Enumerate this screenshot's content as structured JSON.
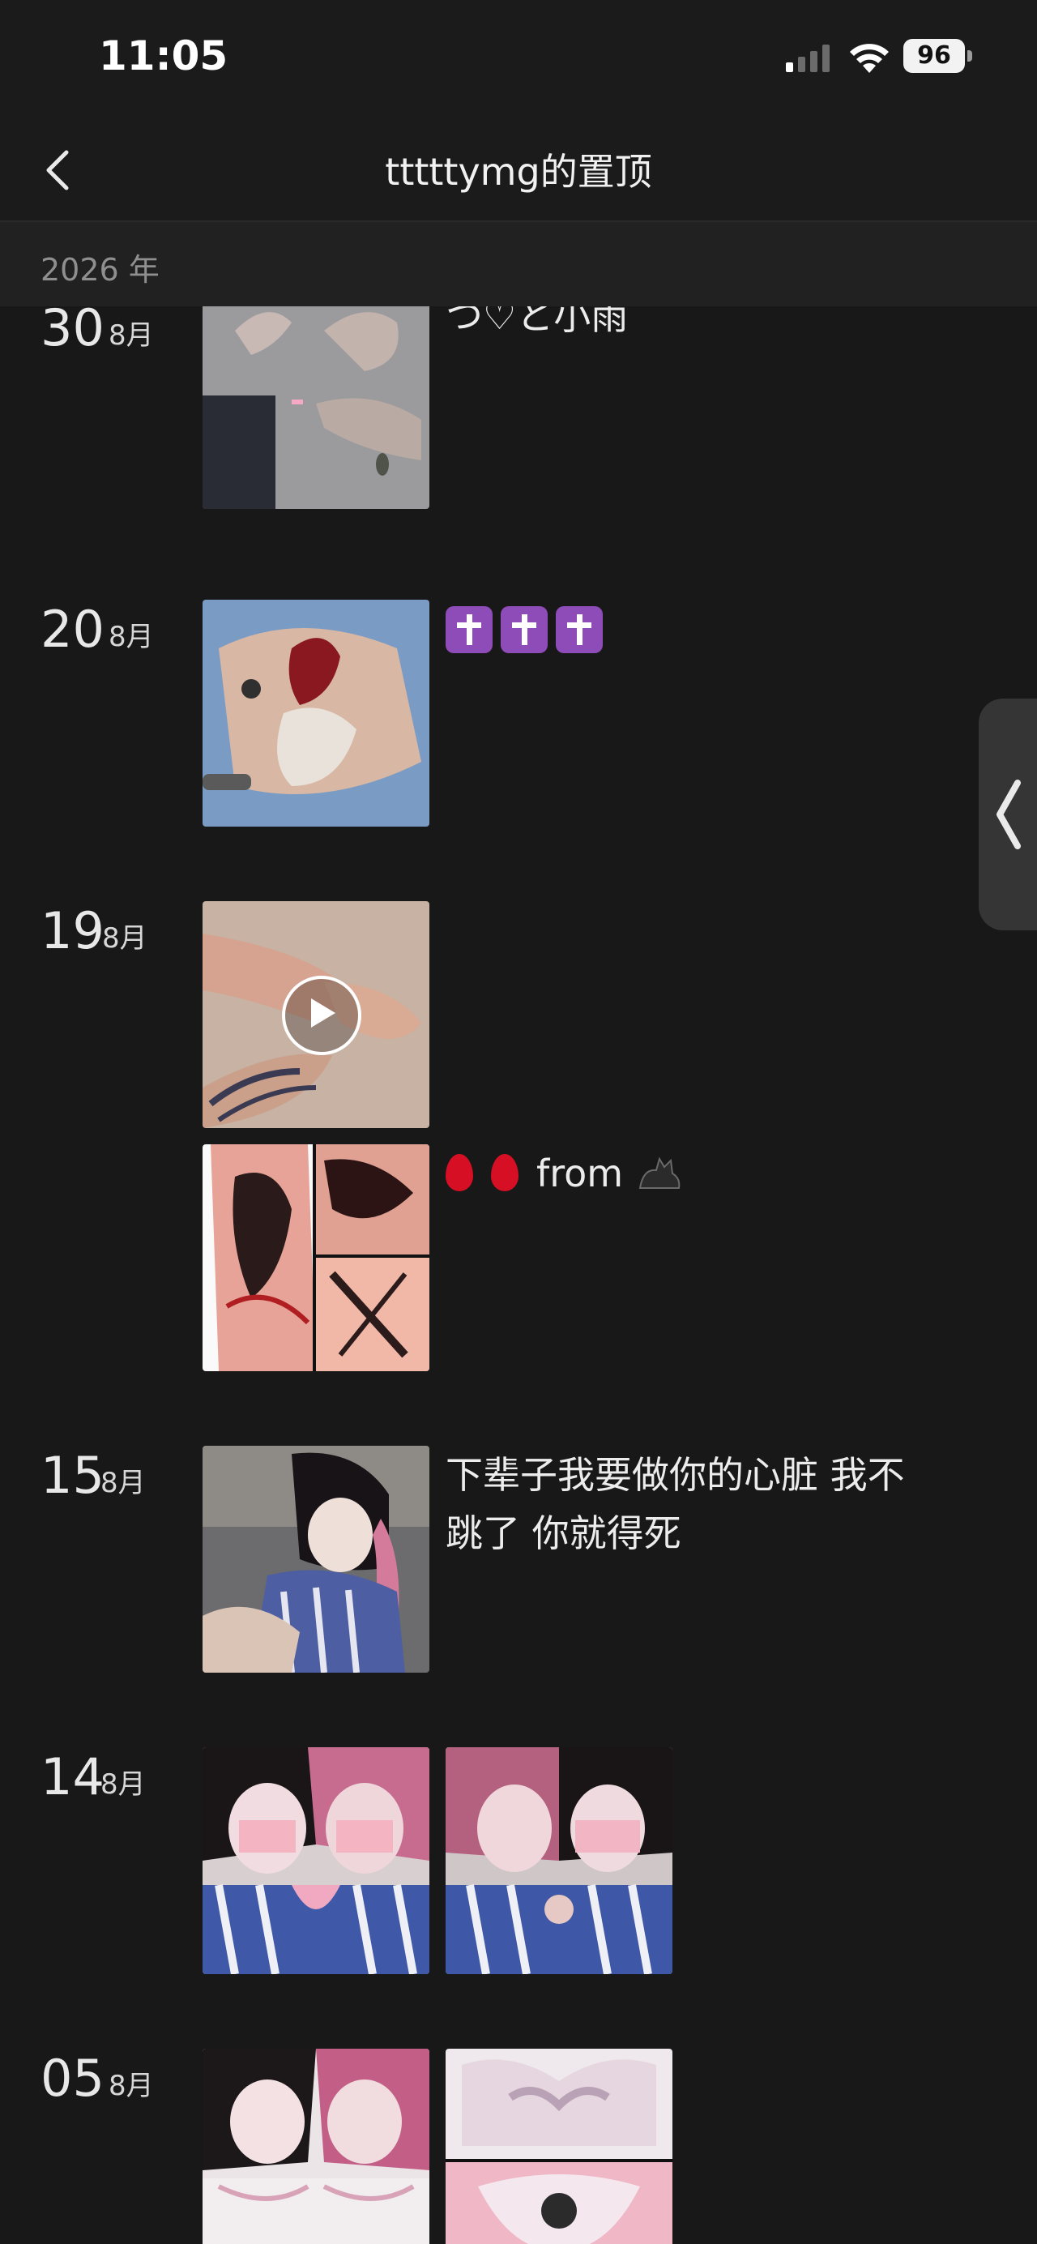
{
  "status_bar": {
    "time": "11:05",
    "battery": "96"
  },
  "nav": {
    "title": "tttttymg的置顶"
  },
  "year_header": "2026 年",
  "entries": [
    {
      "day": "30",
      "month": "8月",
      "text": "つ♡と小雨"
    },
    {
      "day": "20",
      "month": "8月",
      "text": ""
    },
    {
      "day": "19",
      "month": "8月",
      "text": "from"
    },
    {
      "day": "15",
      "month": "8月",
      "text_line1": "下辈子我要做你的心脏 我不",
      "text_line2": "跳了 你就得死"
    },
    {
      "day": "14",
      "month": "8月"
    },
    {
      "day": "05",
      "month": "8月"
    }
  ],
  "colors": {
    "background": "#181818",
    "header": "#1b1b1b",
    "year_bar": "#212121",
    "accent_purple": "#8e4cb8",
    "drop_red": "#d60f25"
  }
}
